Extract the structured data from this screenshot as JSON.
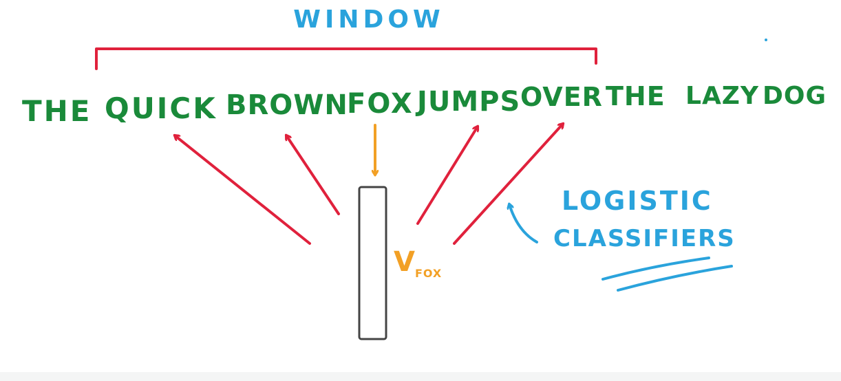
{
  "window_label": "WINDOW",
  "sentence": [
    "THE",
    "QUICK",
    "BROWN",
    "FOX",
    "JUMPS",
    "OVER",
    "THE",
    "LAZY",
    "DOG"
  ],
  "vector_label": {
    "main": "V",
    "sub": "FOX"
  },
  "classifier_label": {
    "line1": "LOGISTIC",
    "line2": "CLASSIFIERS"
  },
  "colors": {
    "blue": "#2aa3dc",
    "green": "#1a8a3a",
    "red": "#e0213c",
    "orange": "#f2a025",
    "gray": "#444444"
  }
}
